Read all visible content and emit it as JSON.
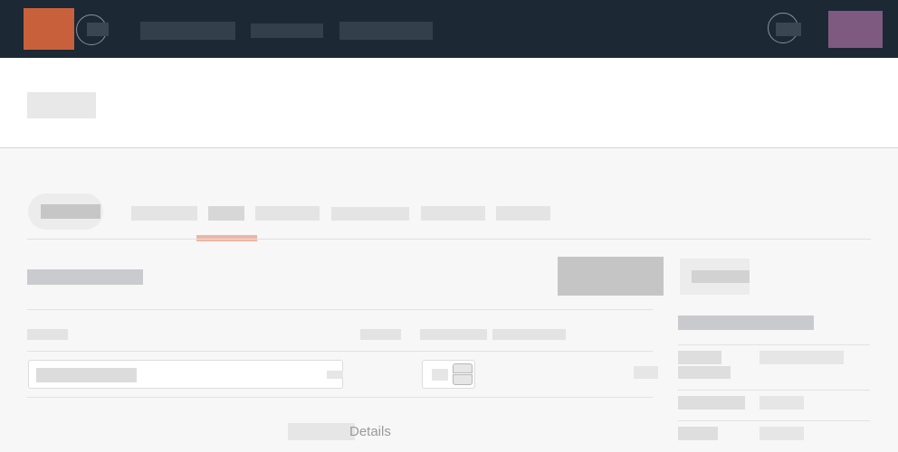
{
  "app": {
    "name": ""
  },
  "topbar": {
    "logo_icon": "app-logo",
    "menu_icon": "menu-icon",
    "nav_links": [
      "",
      "",
      ""
    ],
    "help_icon": "help-icon",
    "avatar_color": "#7e5a80",
    "background": "#1c2833",
    "logo_color": "#c9603c"
  },
  "header": {
    "title": ""
  },
  "tabs": {
    "pill_label": "",
    "items": [
      "",
      "",
      "",
      "",
      "",
      ""
    ],
    "active_index": 1,
    "accent": "#efb5a4"
  },
  "main": {
    "section_title": "",
    "primary_button": "",
    "side_button": "",
    "columns": [
      "",
      "",
      "",
      ""
    ],
    "row": {
      "name_value": "",
      "name_suffix": "",
      "quantity": "",
      "amount": ""
    },
    "details_link": "Details"
  },
  "summary": {
    "title": "",
    "rows": [
      {
        "label": "",
        "label_line2": "",
        "value": ""
      },
      {
        "label": "",
        "value": ""
      },
      {
        "label": "",
        "value": ""
      }
    ]
  }
}
